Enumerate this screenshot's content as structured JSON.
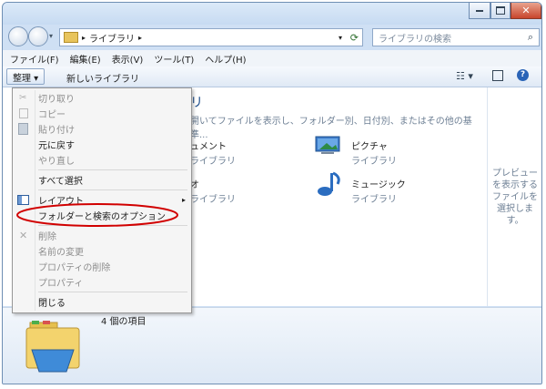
{
  "window": {
    "icons": [
      "minimize-icon",
      "maximize-icon",
      "close-icon"
    ]
  },
  "address": {
    "crumb": "ライブラリ",
    "search_placeholder": "ライブラリの検索"
  },
  "menubar": [
    "ファイル(F)",
    "編集(E)",
    "表示(V)",
    "ツール(T)",
    "ヘルプ(H)"
  ],
  "toolbar": {
    "organize": "整理 ▾",
    "new_library": "新しいライブラリ"
  },
  "content": {
    "heading": "リ",
    "description": "開いてファイルを表示し、フォルダー別、日付別、またはその他の基準...",
    "items": [
      {
        "name": "ドキュメント",
        "sub": "ライブラリ",
        "shown": "ュメント"
      },
      {
        "name": "ピクチャ",
        "sub": "ライブラリ"
      },
      {
        "name": "ビデオ",
        "sub": "ライブラリ",
        "shown": "オ"
      },
      {
        "name": "ミュージック",
        "sub": "ライブラリ"
      }
    ],
    "count": "4 個の項目"
  },
  "preview": [
    "プレビュー",
    "を表示する",
    "ファイルを",
    "選択しま",
    "す。"
  ],
  "menu": {
    "items": [
      {
        "label": "切り取り",
        "disabled": true
      },
      {
        "label": "コピー",
        "disabled": true
      },
      {
        "label": "貼り付け",
        "disabled": true
      },
      {
        "label": "元に戻す",
        "disabled": false
      },
      {
        "label": "やり直し",
        "disabled": true
      },
      {
        "label": "すべて選択",
        "disabled": false
      },
      {
        "label": "レイアウト",
        "disabled": false
      },
      {
        "label": "フォルダーと検索のオプション",
        "disabled": false
      },
      {
        "label": "削除",
        "disabled": true
      },
      {
        "label": "名前の変更",
        "disabled": true
      },
      {
        "label": "プロパティの削除",
        "disabled": true
      },
      {
        "label": "プロパティ",
        "disabled": true
      },
      {
        "label": "閉じる",
        "disabled": false
      }
    ]
  },
  "colors": {
    "highlight_ellipse": "#d10000",
    "accent": "#1f4e8c"
  }
}
